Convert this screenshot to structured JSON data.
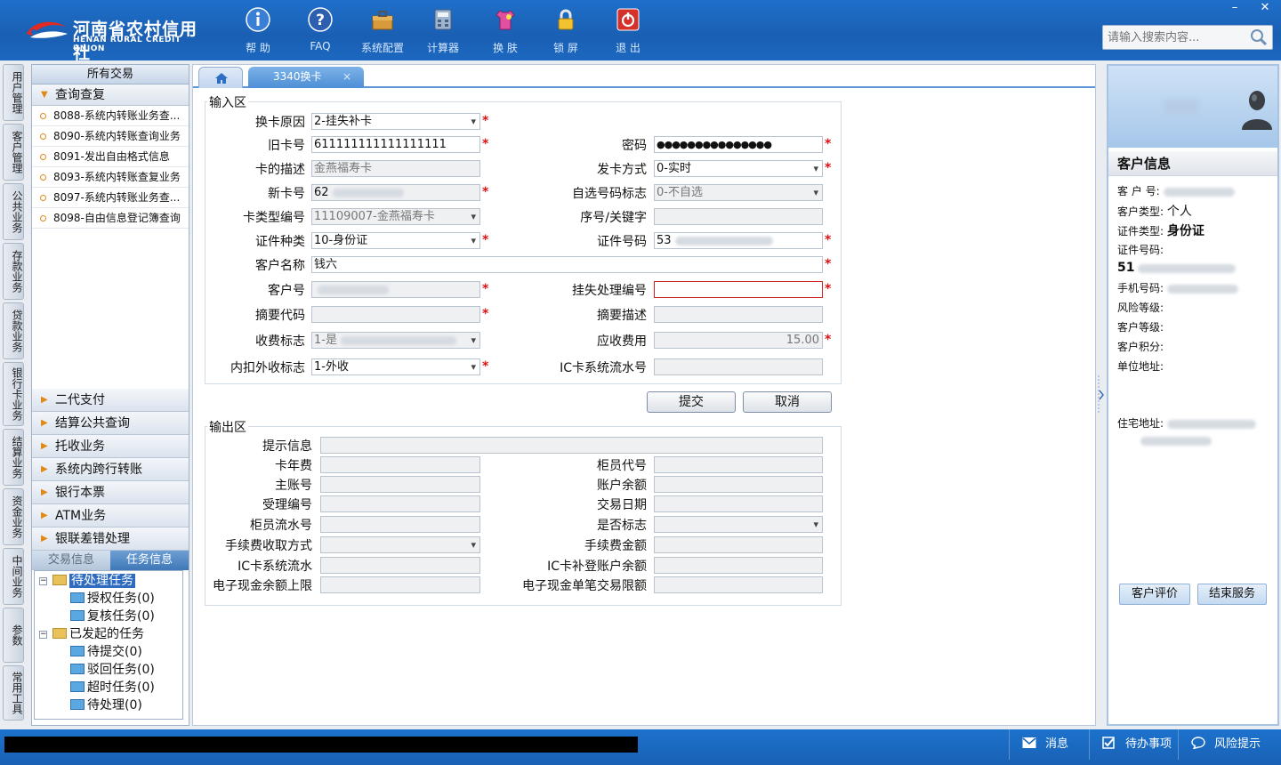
{
  "app": {
    "logo_cn": "河南省农村信用社",
    "logo_en": "HENAN RURAL CREDIT UNION"
  },
  "toolbar": [
    {
      "label": "帮 助",
      "icon": "info-icon"
    },
    {
      "label": "FAQ",
      "icon": "question-icon"
    },
    {
      "label": "系统配置",
      "icon": "toolbox-icon"
    },
    {
      "label": "计算器",
      "icon": "calculator-icon"
    },
    {
      "label": "换 肤",
      "icon": "shirt-icon"
    },
    {
      "label": "锁 屏",
      "icon": "lock-icon"
    },
    {
      "label": "退 出",
      "icon": "power-icon"
    }
  ],
  "search": {
    "placeholder": "请输入搜索内容..."
  },
  "window": {
    "minimize": "–",
    "close": "✕"
  },
  "vtabs": [
    "用户管理",
    "客户管理",
    "公共业务",
    "存款业务",
    "贷款业务",
    "银行卡业务",
    "结算业务",
    "资金业务",
    "中间业务",
    "参数",
    "常用工具"
  ],
  "left": {
    "header": "所有交易",
    "open_group": "查询查复",
    "items": [
      "8088-系统内转账业务查...",
      "8090-系统内转账查询业务",
      "8091-发出自由格式信息",
      "8093-系统内转账查复业务",
      "8097-系统内转账业务查...",
      "8098-自由信息登记簿查询"
    ],
    "groups": [
      "二代支付",
      "结算公共查询",
      "托收业务",
      "系统内跨行转账",
      "银行本票",
      "ATM业务",
      "银联差错处理"
    ],
    "panel_tabs": [
      "交易信息",
      "任务信息"
    ],
    "tree": {
      "pending": "待处理任务",
      "auth": "授权任务(0)",
      "review": "复核任务(0)",
      "initiated": "已发起的任务",
      "to_submit": "待提交(0)",
      "rejected": "驳回任务(0)",
      "timeout": "超时任务(0)",
      "to_process": "待处理(0)"
    }
  },
  "tabs": {
    "active": "3340换卡",
    "close": "×"
  },
  "input": {
    "legend": "输入区",
    "reason_label": "换卡原因",
    "reason_value": "2-挂失补卡",
    "old_card_label": "旧卡号",
    "old_card_value": "611111111111111111",
    "password_label": "密码",
    "password_value": "●●●●●●●●●●●●●●●",
    "desc_label": "卡的描述",
    "desc_value": "金燕福寿卡",
    "issue_label": "发卡方式",
    "issue_value": "0-实时",
    "new_card_label": "新卡号",
    "new_card_value": "62",
    "self_select_label": "自选号码标志",
    "self_select_value": "0-不自选",
    "card_type_label": "卡类型编号",
    "card_type_value": "11109007-金燕福寿卡",
    "seq_label": "序号/关键字",
    "cert_type_label": "证件种类",
    "cert_type_value": "10-身份证",
    "cert_no_label": "证件号码",
    "cert_no_value": "53",
    "cust_name_label": "客户名称",
    "cust_name_value": "钱六",
    "cust_no_label": "客户号",
    "loss_no_label": "挂失处理编号",
    "summary_code_label": "摘要代码",
    "summary_desc_label": "摘要描述",
    "fee_flag_label": "收费标志",
    "fee_flag_value": "1-是",
    "fee_due_label": "应收费用",
    "fee_due_value": "15.00",
    "inout_label": "内扣外收标志",
    "inout_value": "1-外收",
    "ic_serial_label": "IC卡系统流水号"
  },
  "buttons": {
    "submit": "提交",
    "cancel": "取消"
  },
  "output": {
    "legend": "输出区",
    "labels": {
      "hint": "提示信息",
      "card_fee": "卡年费",
      "teller_code": "柜员代号",
      "main_acct": "主账号",
      "balance": "账户余额",
      "accept_no": "受理编号",
      "trade_date": "交易日期",
      "teller_serial": "柜员流水号",
      "yes_no": "是否标志",
      "fee_method": "手续费收取方式",
      "fee_amount": "手续费金额",
      "ic_serial": "IC卡系统流水",
      "ic_balance": "IC卡补登账户余额",
      "ecash_limit": "电子现金余额上限",
      "ecash_single": "电子现金单笔交易限额"
    }
  },
  "customer": {
    "title": "客户信息",
    "no_label": "客 户 号:",
    "type_label": "客户类型:",
    "type_value": "个人",
    "cert_type_label": "证件类型:",
    "cert_type_value": "身份证",
    "cert_no_label": "证件号码:",
    "cert_no_value": "51",
    "phone_label": "手机号码:",
    "risk_label": "风险等级:",
    "level_label": "客户等级:",
    "points_label": "客户积分:",
    "company_label": "单位地址:",
    "home_label": "住宅地址:",
    "eval_button": "客户评价",
    "end_button": "结束服务"
  },
  "status": {
    "msg": "消息",
    "todo": "待办事项",
    "risk": "风险提示"
  }
}
